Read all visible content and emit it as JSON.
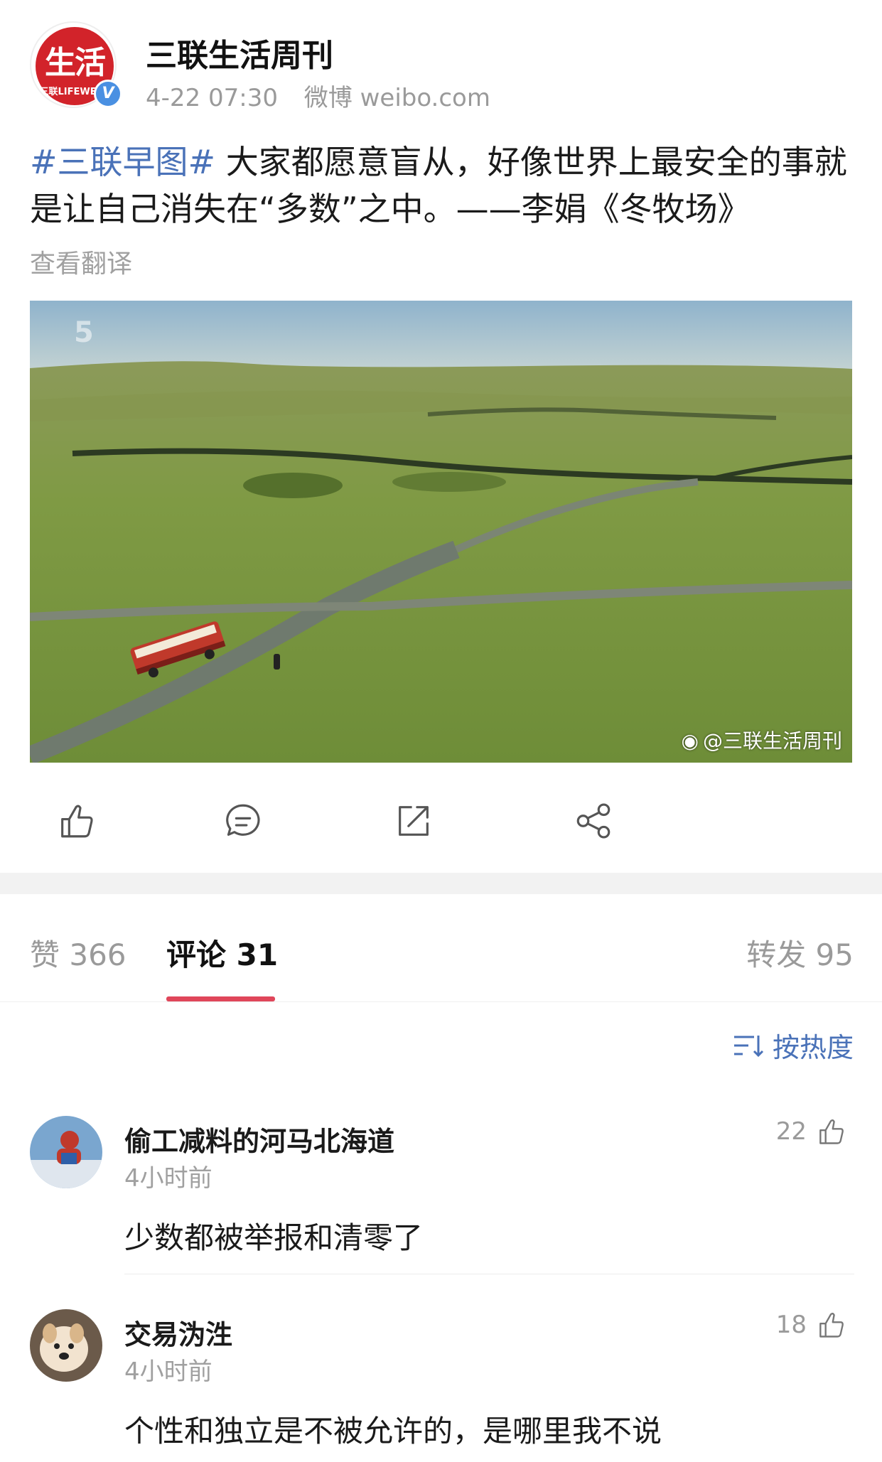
{
  "post": {
    "author": "三联生活周刊",
    "logo_text": "生活",
    "logo_sub": "三联LIFEWEEK",
    "verified": "V",
    "time": "4-22 07:30",
    "source": "微博 weibo.com",
    "hashtag": "#三联早图#",
    "text": " 大家都愿意盲从，好像世界上最安全的事就是让自己消失在“多数”之中。——李娟《冬牧场》",
    "translate_label": "查看翻译",
    "image_watermark": "@三联生活周刊",
    "image_corner_mark": "5"
  },
  "actions": {
    "like_icon": "thumbs-up-icon",
    "comment_icon": "comment-bubble-icon",
    "repost_icon": "repost-icon",
    "share_icon": "share-icon"
  },
  "tabs": {
    "likes": "赞 366",
    "comments": "评论 31",
    "reposts": "转发 95"
  },
  "sort": {
    "label": "按热度"
  },
  "comments": [
    {
      "name": "偷工减料的河马北海道",
      "time": "4小时前",
      "text": "少数都被举报和清零了",
      "likes": "22"
    },
    {
      "name": "交易沩泩",
      "time": "4小时前",
      "text": "个性和独立是不被允许的，是哪里我不说",
      "likes": "18"
    }
  ],
  "colors": {
    "accent_link": "#4a72b8",
    "tab_underline": "#e0465a",
    "brand_red": "#d2232a",
    "verified_blue": "#4a90e2"
  }
}
